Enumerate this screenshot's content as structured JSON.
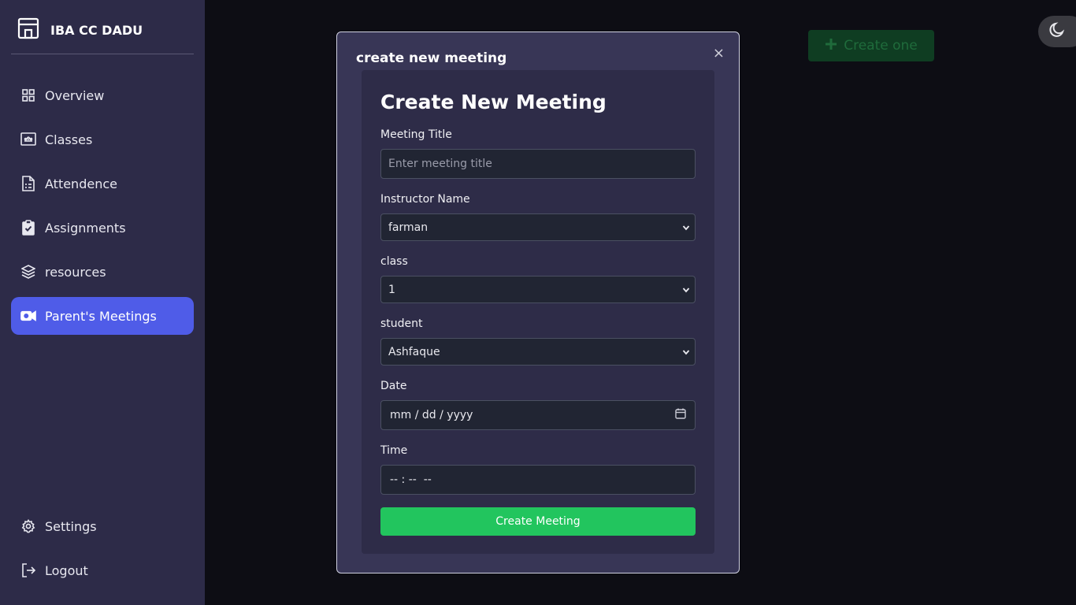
{
  "app": {
    "brand": "IBA CC DADU"
  },
  "sidebar": {
    "items": [
      {
        "label": "Overview",
        "icon": "grid-icon"
      },
      {
        "label": "Classes",
        "icon": "presentation-icon"
      },
      {
        "label": "Attendence",
        "icon": "document-icon"
      },
      {
        "label": "Assignments",
        "icon": "clipboard-check-icon"
      },
      {
        "label": "resources",
        "icon": "layers-icon"
      },
      {
        "label": "Parent's Meetings",
        "icon": "video-icon",
        "active": true
      }
    ],
    "footer": [
      {
        "label": "Settings",
        "icon": "gear-icon"
      },
      {
        "label": "Logout",
        "icon": "logout-icon"
      }
    ]
  },
  "background": {
    "create_label": "Create one"
  },
  "modal": {
    "title": "create new meeting",
    "close": "×",
    "heading": "Create New Meeting",
    "fields": {
      "meeting_title": {
        "label": "Meeting Title",
        "placeholder": "Enter meeting title"
      },
      "instructor": {
        "label": "Instructor Name",
        "value": "farman"
      },
      "class": {
        "label": "class",
        "value": "1"
      },
      "student": {
        "label": "student",
        "value": "Ashfaque"
      },
      "date": {
        "label": "Date",
        "value": "mm / dd / yyyy"
      },
      "time": {
        "label": "Time",
        "value": "-- : --  --"
      }
    },
    "submit_label": "Create Meeting"
  },
  "colors": {
    "sidebar": "#2d2b48",
    "active": "#4f5ce8",
    "modal": "#383656",
    "card": "#2e2c48",
    "submit": "#22c55e"
  }
}
